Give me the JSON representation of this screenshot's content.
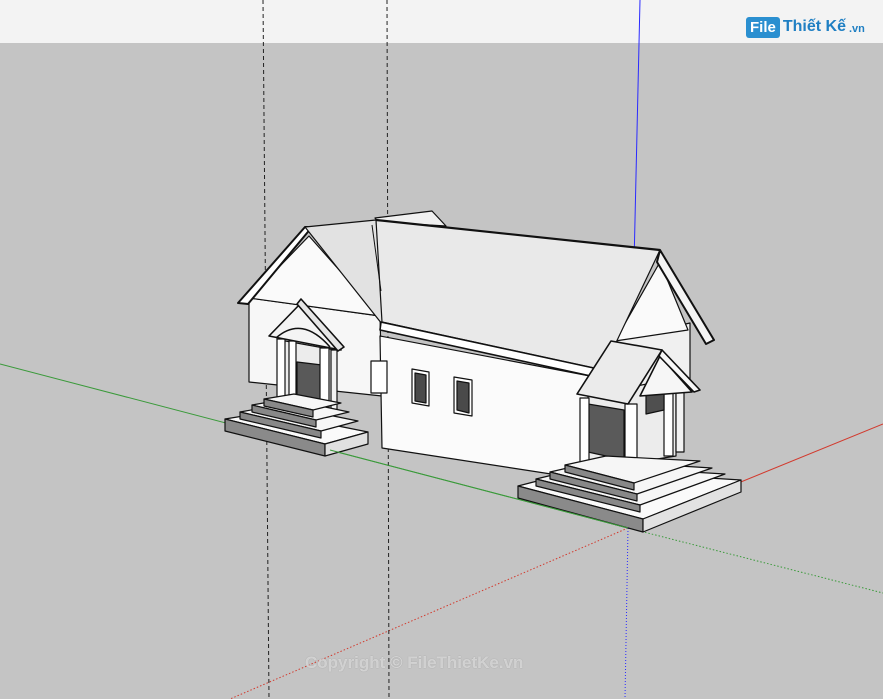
{
  "logo": {
    "badge": "File",
    "name": "Thiết Kế",
    "suffix": ".vn"
  },
  "watermark": "Copyright © FileThietKe.vn",
  "colors": {
    "sky": "#f3f3f3",
    "ground": "#c4c4c4",
    "axis_red": "#d23a2e",
    "axis_green": "#3a9a3a",
    "axis_blue": "#2a2aff",
    "logo_blue": "#2a8fd0"
  },
  "icons": {
    "logo": "filethietke-logo"
  }
}
